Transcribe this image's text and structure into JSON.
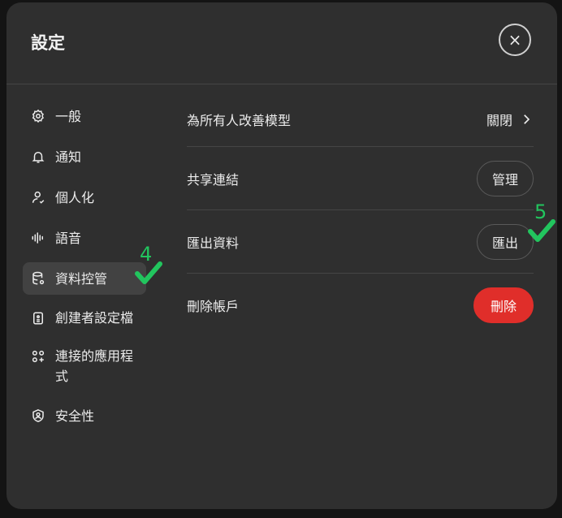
{
  "dialog": {
    "title": "設定",
    "close_label": "×"
  },
  "sidebar": {
    "items": [
      {
        "label": "一般",
        "icon": "gear-icon"
      },
      {
        "label": "通知",
        "icon": "bell-icon"
      },
      {
        "label": "個人化",
        "icon": "person-icon"
      },
      {
        "label": "語音",
        "icon": "waveform-icon"
      },
      {
        "label": "資料控管",
        "icon": "database-icon",
        "active": true
      },
      {
        "label": "創建者設定檔",
        "icon": "id-card-icon"
      },
      {
        "label": "連接的應用程式",
        "icon": "apps-icon"
      },
      {
        "label": "安全性",
        "icon": "shield-icon"
      }
    ]
  },
  "content": {
    "rows": [
      {
        "label": "為所有人改善模型",
        "action": "關閉"
      },
      {
        "label": "共享連結",
        "action": "管理"
      },
      {
        "label": "匯出資料",
        "action": "匯出"
      },
      {
        "label": "刪除帳戶",
        "action": "刪除"
      }
    ]
  },
  "annotations": {
    "mark_4": "4",
    "mark_5": "5",
    "color": "#22c55e"
  },
  "colors": {
    "danger": "#e02e2a",
    "background": "#2f2f2f"
  }
}
